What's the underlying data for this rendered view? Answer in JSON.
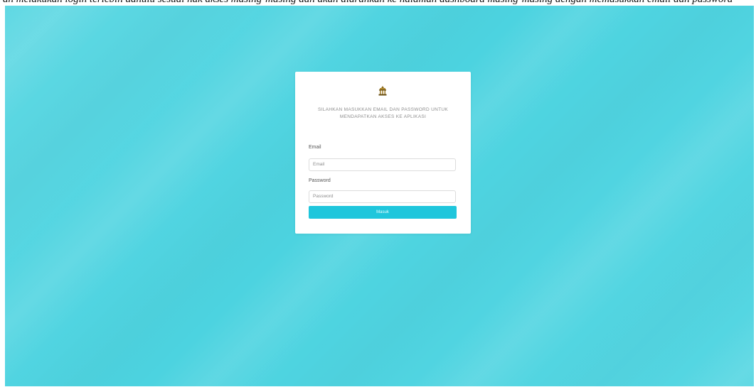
{
  "caption": "an melakukan login terlebih dahulu sesuai hak akses masing-masing dan akan diarahkan ke halaman dashboard masing-masing dengan memasukkan email dan password",
  "login": {
    "instruction": "Silahkan masukkan email dan password untuk mendapatkan akses ke aplikasi",
    "email_label": "Email",
    "email_placeholder": "Email",
    "password_label": "Password",
    "password_placeholder": "Password",
    "submit_label": "Masuk",
    "logo_icon": "emblem-icon"
  },
  "colors": {
    "background": "#4cd3e0",
    "button": "#1fc6dc",
    "card": "#ffffff"
  }
}
